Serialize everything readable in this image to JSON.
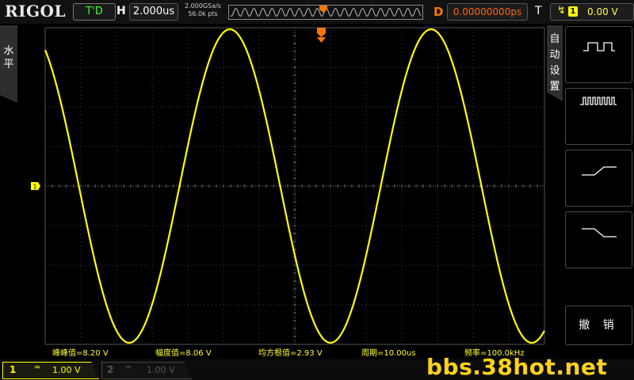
{
  "topbar": {
    "logo": "RIGOL",
    "run_status": "T'D",
    "horizontal_label": "H",
    "timebase": "2.000us",
    "sample_rate": "2.000GSa/s",
    "mem_depth": "56.0k pts",
    "delay_label": "D",
    "delay_value": "0.00000000ps",
    "trigger_label": "T",
    "trigger_source": "1",
    "trigger_level": "0.00 V"
  },
  "left_tab": {
    "label": "水平"
  },
  "channel_marker": "1",
  "right_menu": {
    "title": "自动设置",
    "options": [
      {
        "icon": "single-period-icon"
      },
      {
        "icon": "multi-period-icon"
      },
      {
        "icon": "rising-edge-icon"
      },
      {
        "icon": "falling-edge-icon"
      }
    ],
    "cancel_label": "撤 销"
  },
  "measurements": [
    {
      "label": "峰峰值=8.20 V"
    },
    {
      "label": "幅度值=8.06 V"
    },
    {
      "label": "均方根值=2.93 V"
    },
    {
      "label": "周期=10.00us"
    },
    {
      "label": "频率=100.0kHz"
    }
  ],
  "bottombar": {
    "ch1_num": "1",
    "ch1_coupling": "═",
    "ch1_scale": "1.00 V",
    "ch2_num": "2",
    "ch2_coupling": "═",
    "ch2_scale": "1.00 V",
    "watermark": "bbs.38hot.net"
  },
  "colors": {
    "trace": "#ffff00",
    "grid": "#404040",
    "trigger": "#ff7a00",
    "watermark": "#ffd21a"
  },
  "waveform": {
    "type": "sine",
    "periods_visible": 2.5,
    "amplitude_divs": 4.1,
    "period_us": 10.0
  }
}
